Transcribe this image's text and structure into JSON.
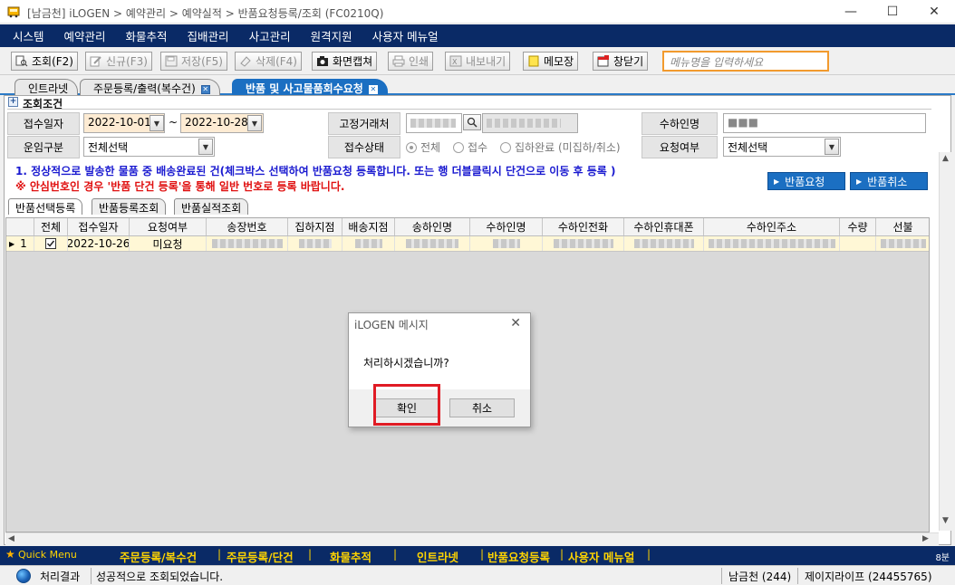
{
  "window": {
    "title": "[남금천] iLOGEN > 예약관리 > 예약실적 > 반품요청등록/조회 (FC0210Q)",
    "minimize_glyph": "—",
    "maximize_glyph": "☐",
    "close_glyph": "✕"
  },
  "menu": [
    "시스템",
    "예약관리",
    "화물추적",
    "집배관리",
    "사고관리",
    "원격지원",
    "사용자 메뉴얼"
  ],
  "toolbar": {
    "query": "조회(F2)",
    "new": "신규(F3)",
    "save": "저장(F5)",
    "delete": "삭제(F4)",
    "capture": "화면캡쳐",
    "print": "인쇄",
    "export": "내보내기",
    "memo": "메모장",
    "new_window": "창닫기",
    "menu_search_placeholder": "메뉴명을 입력하세요"
  },
  "tabs": [
    {
      "label": "인트라넷",
      "active": false
    },
    {
      "label": "주문등록/출력(복수건)",
      "active": false
    },
    {
      "label": "반품 및 사고물품회수요청",
      "active": true
    }
  ],
  "search": {
    "section_title": "조회조건",
    "receipt_date_label": "접수일자",
    "date_from": "2022-10-01",
    "date_to": "2022-10-28",
    "date_separator": "~",
    "fixed_client_label": "고정거래처",
    "receiver_name_label": "수하인명",
    "receiver_name_value": "■■■",
    "freight_type_label": "운임구분",
    "freight_type_value": "전체선택",
    "receipt_status_label": "접수상태",
    "status_options": [
      "전체",
      "접수",
      "집하완료 (미집하/취소)"
    ],
    "request_label": "요청여부",
    "request_value": "전체선택"
  },
  "notices": {
    "line1": "1. 정상적으로 발송한 물품 중 배송완료된 건(체크박스 선택하여 반품요청 등록합니다. 또는 행 더블클릭시 단건으로 이동 후 등록 )",
    "line2": "※ 안심번호인 경우 '반품 단건 등록'을 통해 일반 번호로 등록 바랍니다."
  },
  "actions": {
    "return_request": "반품요청",
    "return_cancel": "반품취소"
  },
  "subtabs": [
    "반품선택등록",
    "반품등록조회",
    "반품실적조회"
  ],
  "grid": {
    "columns": [
      "전체",
      "접수일자",
      "요청여부",
      "송장번호",
      "집하지점",
      "배송지점",
      "송하인명",
      "수하인명",
      "수하인전화",
      "수하인휴대폰",
      "수하인주소",
      "수량",
      "선불"
    ],
    "rows": [
      {
        "no": "1",
        "checked": true,
        "date": "2022-10-26",
        "requested": "미요청"
      }
    ]
  },
  "dialog": {
    "title": "iLOGEN 메시지",
    "message": "처리하시겠습니까?",
    "ok": "확인",
    "cancel": "취소"
  },
  "quickbar": {
    "label": "Quick Menu",
    "items": [
      "주문등록/복수건",
      "주문등록/단건",
      "화물추적",
      "인트라넷",
      "반품요청등록",
      "사용자 메뉴얼"
    ],
    "right_text": "8분"
  },
  "status": {
    "label": "처리결과",
    "message": "성공적으로 조회되었습니다.",
    "branch": "남금천 (244)",
    "company": "제이지라이프 (24455765)"
  },
  "colors": {
    "menubar": "#0a2a66",
    "accent": "#1b6fc2",
    "notice_blue": "#1a1ad0",
    "notice_red": "#e01010",
    "highlight": "#e01b24",
    "quick_text": "#ffd400"
  }
}
